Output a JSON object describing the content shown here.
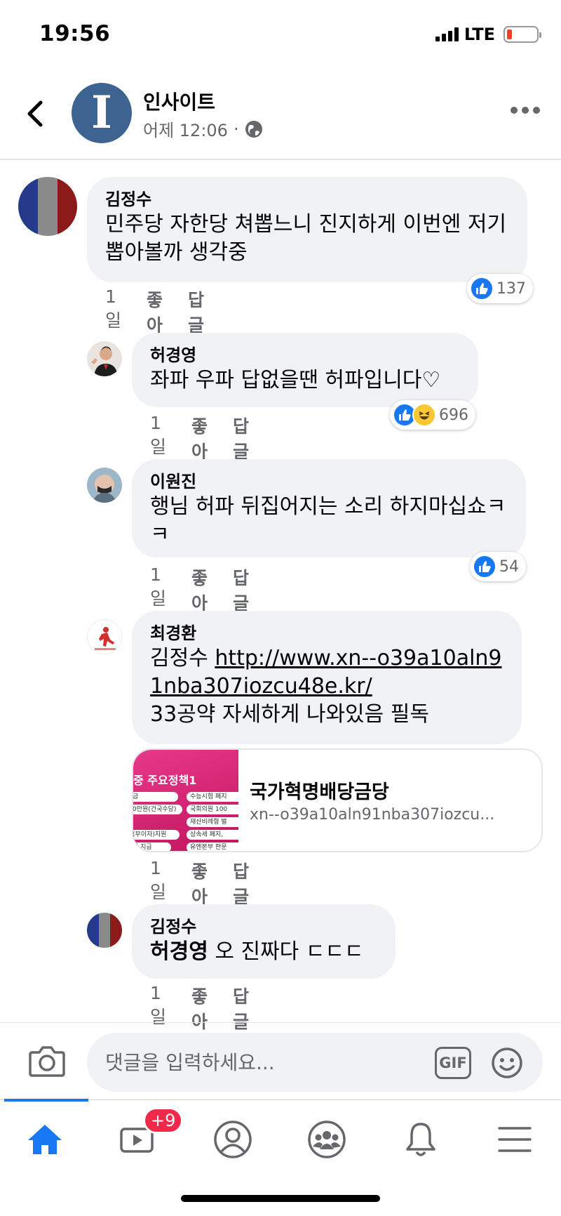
{
  "status_bar": {
    "time": "19:56",
    "network": "LTE"
  },
  "post": {
    "page_name": "인사이트",
    "page_initial": "I",
    "time": "어제 12:06",
    "separator": "·"
  },
  "comments": [
    {
      "name": "김정수",
      "text": "민주당 자한당 쳐뽑느니 진지하게 이번엔 저기 뽑아볼까 생각중",
      "time": "1일",
      "like": "좋아요",
      "reply": "답글 달기",
      "reaction_count": "137"
    },
    {
      "name": "허경영",
      "text": "좌파 우파 답없을땐 허파입니다♡",
      "time": "1일",
      "like": "좋아요",
      "reply": "답글 달기",
      "reaction_count": "696"
    },
    {
      "name": "이원진",
      "text": "행님 허파 뒤집어지는 소리 하지마십쇼ㅋㅋ",
      "time": "1일",
      "like": "좋아요",
      "reply": "답글 달기",
      "reaction_count": "54"
    },
    {
      "name": "최경환",
      "text_prefix": "김정수 ",
      "link": "http://www.xn--o39a10aln91nba307iozcu48e.kr/",
      "text_suffix": "33공약 자세하게 나와있음 필독",
      "time": "1일",
      "like": "좋아요",
      "reply": "답글 달기"
    },
    {
      "name": "김정수",
      "mention": "허경영",
      "text": " 오 진짜다 ㄷㄷㄷ",
      "time": "1일",
      "like": "좋아요",
      "reply": "답글 달기"
    }
  ],
  "link_preview": {
    "title": "국가혁명배당금당",
    "url": "xn--o39a10aln91nba307iozcu...",
    "thumb_heading": "중 주요정책1",
    "thumb_items": [
      "금",
      "수능시험 폐지",
      "0만원(건국수당)",
      "국회의원 100",
      "재산비례형 벌",
      "(무이자)지원",
      "상속세 폐지,",
      "원 지급",
      "유엔본부 판문"
    ]
  },
  "input": {
    "placeholder": "댓글을 입력하세요...",
    "gif_label": "GIF"
  },
  "tabbar": {
    "video_badge": "+9"
  },
  "colors": {
    "accent": "#1877f2",
    "bubble": "#f0f2f5",
    "secondary_text": "#65676b",
    "badge": "#f02849"
  }
}
